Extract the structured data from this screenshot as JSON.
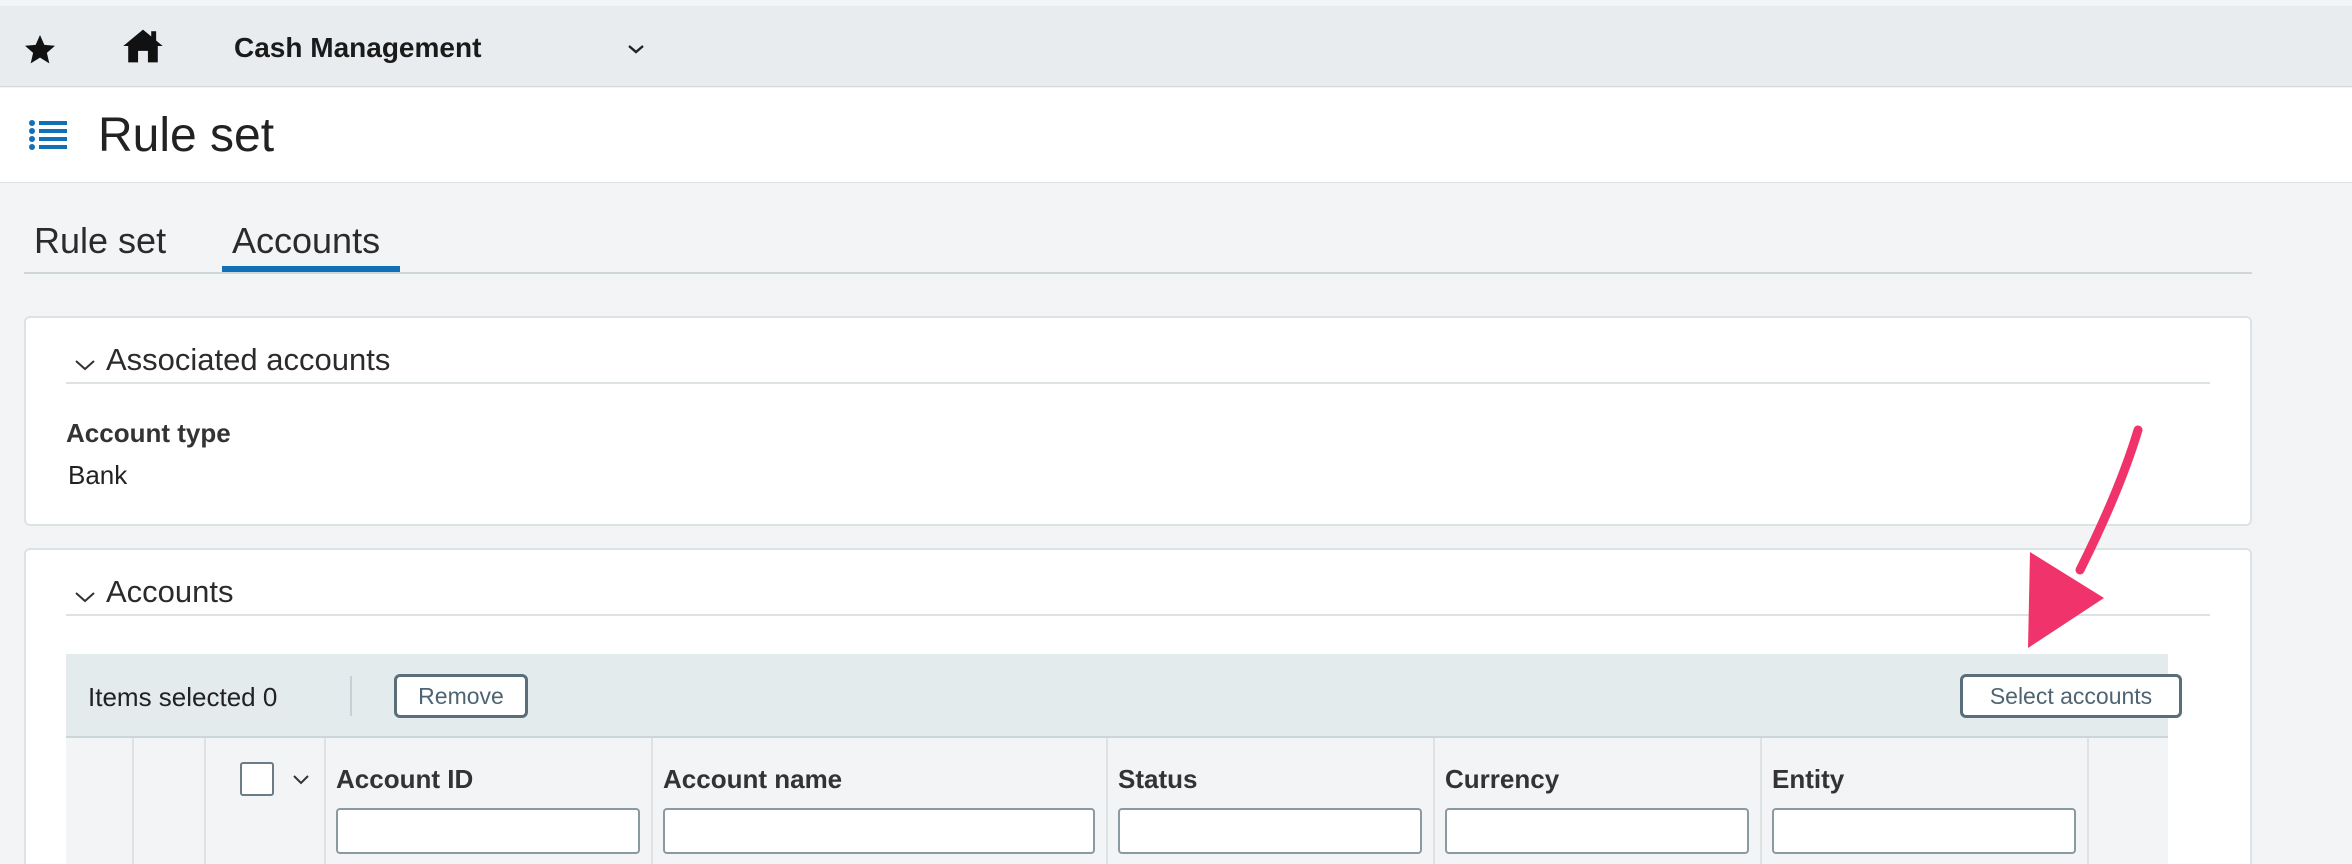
{
  "topbar": {
    "module_name": "Cash Management",
    "icons": {
      "favorite": "star-icon",
      "home": "home-icon",
      "module_menu": "chevron-down-icon"
    }
  },
  "titlebar": {
    "title": "Rule set",
    "icons": {
      "menu": "list-icon"
    }
  },
  "tabs": [
    {
      "label": "Rule set",
      "active": false
    },
    {
      "label": "Accounts",
      "active": true
    }
  ],
  "associated_accounts": {
    "section_title": "Associated accounts",
    "account_type_label": "Account type",
    "account_type_value": "Bank"
  },
  "accounts": {
    "section_title": "Accounts",
    "toolbar": {
      "items_selected": "Items selected 0",
      "remove_label": "Remove",
      "select_accounts_label": "Select accounts"
    },
    "columns": [
      {
        "label": "Account ID",
        "filter_value": ""
      },
      {
        "label": "Account name",
        "filter_value": ""
      },
      {
        "label": "Status",
        "filter_value": ""
      },
      {
        "label": "Currency",
        "filter_value": ""
      },
      {
        "label": "Entity",
        "filter_value": ""
      }
    ]
  },
  "colors": {
    "accent": "#1071b8",
    "annotation_arrow": "#f0336b",
    "topbar_bg": "#e8ecee",
    "toolbar_bg": "#e3ebed"
  }
}
